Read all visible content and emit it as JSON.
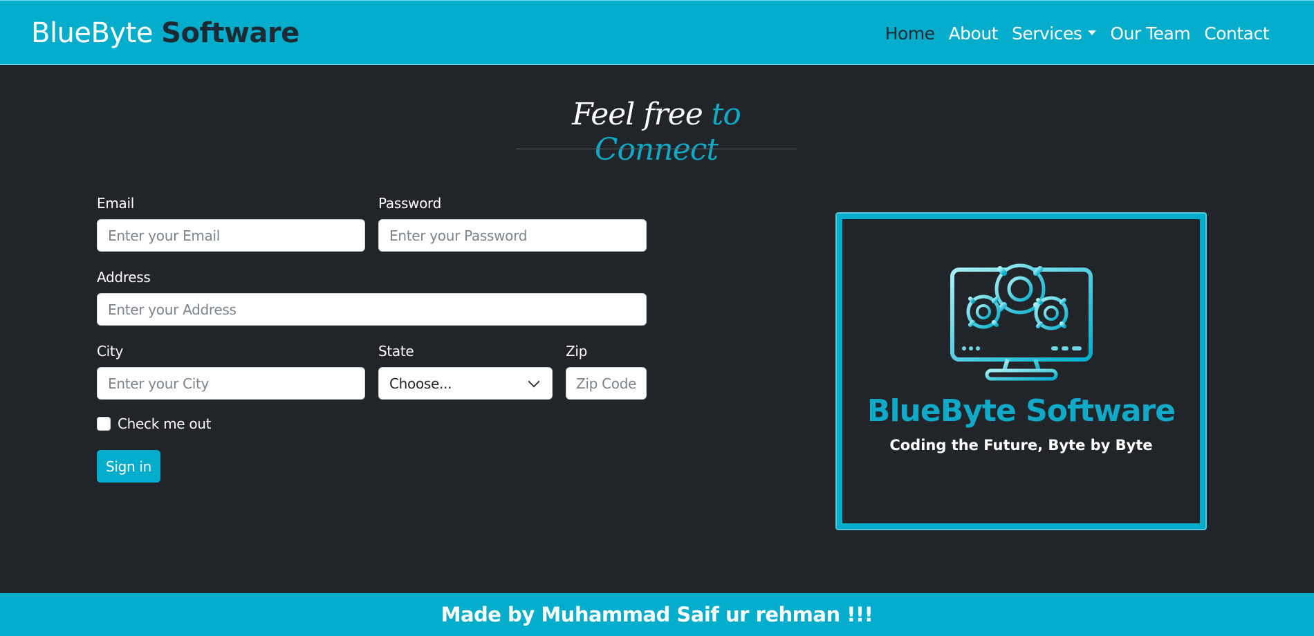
{
  "brand": {
    "light": "BlueByte",
    "bold": "Software"
  },
  "nav": {
    "items": [
      {
        "label": "Home",
        "active": true
      },
      {
        "label": "About",
        "active": false
      },
      {
        "label": "Services",
        "active": false,
        "dropdown": true
      },
      {
        "label": "Our Team",
        "active": false
      },
      {
        "label": "Contact",
        "active": false
      }
    ]
  },
  "heading": {
    "part1": "Feel free ",
    "part2": "to Connect"
  },
  "form": {
    "email": {
      "label": "Email",
      "placeholder": "Enter your Email",
      "value": ""
    },
    "password": {
      "label": "Password",
      "placeholder": "Enter your Password",
      "value": ""
    },
    "address": {
      "label": "Address",
      "placeholder": "Enter your Address",
      "value": ""
    },
    "city": {
      "label": "City",
      "placeholder": "Enter your City",
      "value": ""
    },
    "state": {
      "label": "State",
      "selected": "Choose..."
    },
    "zip": {
      "label": "Zip",
      "placeholder": "Zip Code",
      "value": ""
    },
    "checkbox": {
      "label": "Check me out",
      "checked": false
    },
    "submit": "Sign in"
  },
  "logo": {
    "title": "BlueByte Software",
    "tagline": "Coding the Future, Byte by Byte",
    "icon": "computer-gears-icon"
  },
  "footer": {
    "text": "Made by Muhammad Saif ur rehman !!!"
  },
  "colors": {
    "primary": "#04adcc",
    "background": "#212529",
    "accent_text": "#10a9c8",
    "dark_text": "#1e2a33"
  }
}
